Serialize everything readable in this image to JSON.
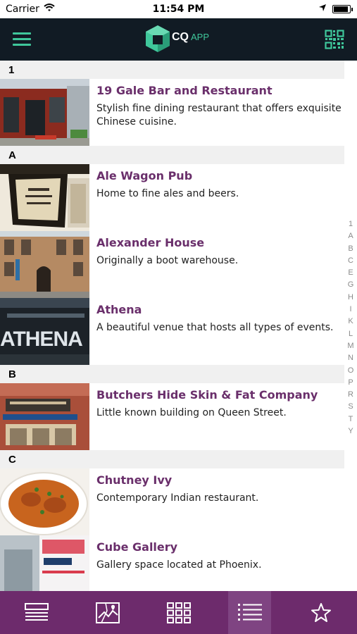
{
  "status_bar": {
    "carrier": "Carrier",
    "time": "11:54 PM",
    "battery_level": 0.9
  },
  "nav": {
    "logo_text": "CQ",
    "logo_sub": "APP",
    "menu_icon": "hamburger-menu-icon",
    "qr_icon": "qr-code-icon"
  },
  "sections": [
    {
      "header": "1",
      "items": [
        {
          "title": "19 Gale Bar and Restaurant",
          "description": "Stylish fine dining restaurant that offers exquisite Chinese cuisine.",
          "thumb": "restaurant-storefront"
        }
      ]
    },
    {
      "header": "A",
      "items": [
        {
          "title": "Ale Wagon Pub",
          "description": "Home to fine ales and beers.",
          "thumb": "pub-sign"
        },
        {
          "title": "Alexander House",
          "description": "Originally a boot warehouse.",
          "thumb": "brick-building"
        },
        {
          "title": "Athena",
          "description": "A beautiful venue that hosts all types of events.",
          "thumb": "athena-sign"
        }
      ]
    },
    {
      "header": "B",
      "items": [
        {
          "title": "Butchers Hide Skin & Fat Company",
          "description": "Little known building on Queen Street.",
          "thumb": "queen-street-building"
        }
      ]
    },
    {
      "header": "C",
      "items": [
        {
          "title": "Chutney Ivy",
          "description": "Contemporary Indian restaurant.",
          "thumb": "curry-dish"
        },
        {
          "title": "Cube Gallery",
          "description": "Gallery space located at Phoenix.",
          "thumb": "gallery-sign"
        }
      ]
    }
  ],
  "index_letters": [
    "1",
    "A",
    "B",
    "C",
    "E",
    "G",
    "H",
    "I",
    "K",
    "L",
    "M",
    "N",
    "O",
    "P",
    "R",
    "S",
    "T",
    "Y"
  ],
  "tabs": [
    {
      "name": "list-view-icon",
      "active": false
    },
    {
      "name": "map-icon",
      "active": false
    },
    {
      "name": "grid-icon",
      "active": false
    },
    {
      "name": "az-list-icon",
      "active": true
    },
    {
      "name": "favorites-star-icon",
      "active": false
    }
  ],
  "colors": {
    "nav_bg": "#111b24",
    "accent_green": "#3fc79b",
    "title_purple": "#6a2f6b",
    "tab_bg": "#6d2b6c",
    "tab_active": "#7f4482"
  }
}
